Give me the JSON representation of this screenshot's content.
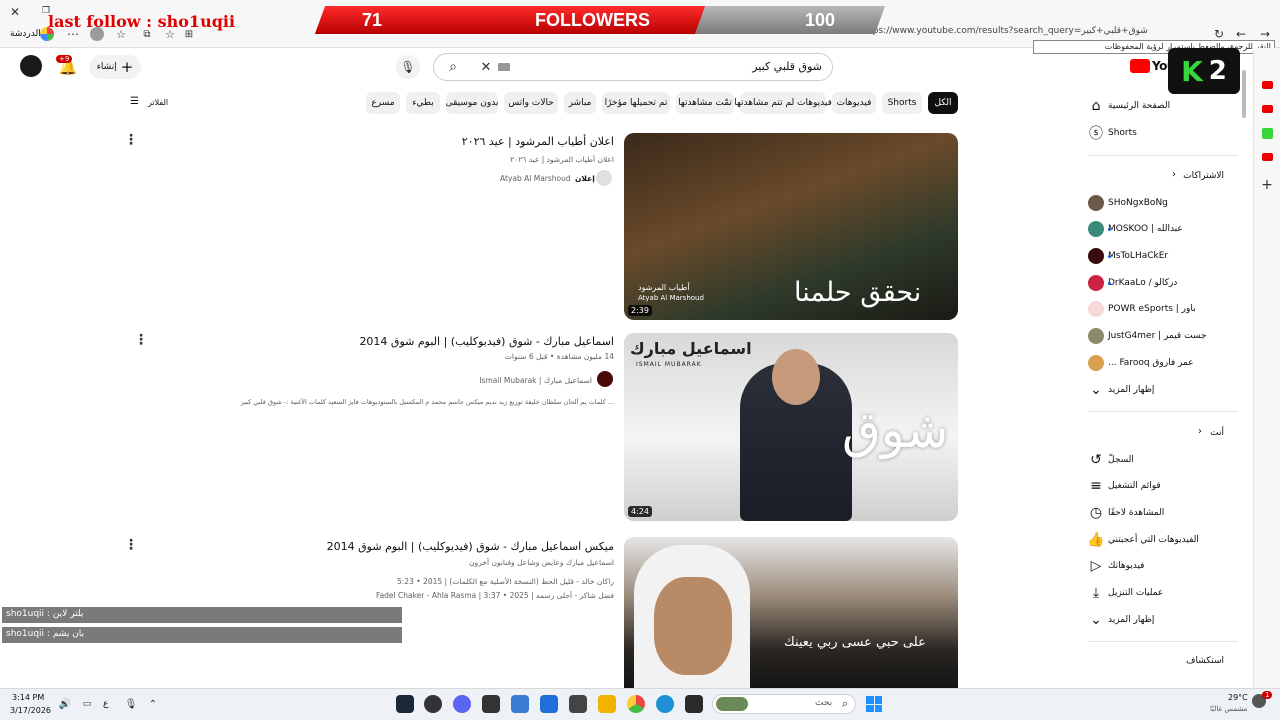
{
  "overlay": {
    "last_follow": "last follow : sho1uqii",
    "followers_current": "71",
    "followers_label": "FOLLOWERS",
    "followers_goal": "100"
  },
  "browser": {
    "chat_label": "الدردشة",
    "address": "https://www.youtube.com/results?search_query=شوق+قلبي+كبير",
    "tooltip": "النقر للرجوع، والضغط باستمرار لرؤية المحفوظات"
  },
  "youtube": {
    "logo_text": "YouTube",
    "search_value": "شوق قلبي كبير",
    "create_label": "إنشاء",
    "notif_badge": "+9",
    "filters_label": "الفلاتر",
    "chips": [
      "الكل",
      "Shorts",
      "فيديوهات",
      "فيديوهات لم تتم مشاهدتها",
      "تمّت مشاهدتها",
      "تم تحميلها مؤخرًا",
      "مباشر",
      "حالات واتس",
      "بدون موسيقى",
      "بطيء",
      "مسرع"
    ],
    "sidebar": {
      "home": "الصفحة الرئيسية",
      "shorts": "Shorts",
      "subs_title": "الاشتراكات",
      "subs": [
        "SHoNgxBoNg",
        "عبدالله | MOSKOO",
        "MsToLHaCkEr",
        "دركالو / DrKaaLo",
        "باور | POWR eSports",
        "جست قيمر | JustG4mer",
        "عمر فاروق Farooq ..."
      ],
      "show_more": "إظهار المزيد",
      "you_title": "أنت",
      "you_items": [
        "السجلّ",
        "قوائم التشغيل",
        "المشاهدة لاحقًا",
        "الفيديوهات التي أعجبتني",
        "فيديوهاتك",
        "عمليات التنزيل",
        "إظهار المزيد"
      ],
      "explore_title": "استكشاف"
    },
    "results": [
      {
        "title": "اعلان أطياب المرشود | عيد ٢٠٢٦",
        "meta": "اعلان أطياب المرشود | عيد ٢٠٢٦",
        "channel": "Atyab Al Marshoud",
        "badge": "إعلان",
        "duration": "2:39",
        "thumb_brand": "أطياب المرشود",
        "thumb_brand_en": "Atyab Al Marshoud",
        "thumb_caption": "نحقق حلمنا"
      },
      {
        "title": "اسماعيل مبارك - شوق (فيديوكليب) | البوم شوق 2014",
        "meta": "14 مليون مشاهدة • قبل 6 سنوات",
        "channel": "اسماعيل مبارك | Ismail Mubarak",
        "desc": "... كلمات يم ألحان سلطان خليفة توزيع زيد نديم ميكس جاسم محمد م المكسيل بالستوديوهات فايز السعيد كلمات الأغنية :- شوق قلبي كبير",
        "duration": "4:24",
        "thumb_name": "اسماعيل مبارك",
        "thumb_name_en": "ISMAIL MUBARAK",
        "thumb_caption": "شوق"
      },
      {
        "title": "ميكس اسماعيل مبارك - شوق (فيديوكليب) | البوم شوق 2014",
        "meta": "اسماعيل مبارك وعايض وشاعل وفنانون آخرون",
        "line1": "راكان خالد - قليل الحظ (النسخة الأصلية مع الكلمات) | 2015 • 5:23",
        "line2": "فضل شاكر - أحلى رسمه | 2025 • 3:37 | Fadel Chaker - Ahla Rasma",
        "thumb_caption": "على حبي عسى ربي يعينك"
      }
    ]
  },
  "chat": [
    {
      "user": "sho1uqii",
      "msg": "يلتر لاين"
    },
    {
      "user": "sho1uqii",
      "msg": "بان يشم"
    }
  ],
  "taskbar": {
    "time": "3:14 PM",
    "date": "3/17/2026",
    "search_placeholder": "بحث",
    "weather_temp": "29°C",
    "weather_desc": "مشمس غالبًا",
    "lang": "ع",
    "tray_badge": "1"
  },
  "stream_badge": "2"
}
